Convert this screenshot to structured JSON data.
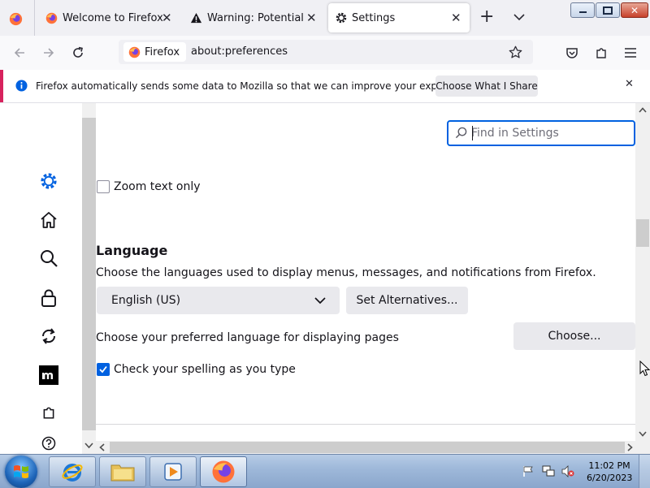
{
  "tabs": [
    {
      "title": "Welcome to Firefox",
      "close": "✕"
    },
    {
      "title": "Warning: Potential Sec",
      "close": "✕"
    },
    {
      "title": "Settings",
      "close": "✕"
    }
  ],
  "tab_controls": {
    "new_tab": "+",
    "list_all": "⌄"
  },
  "navbar": {
    "identity_label": "Firefox",
    "url": "about:preferences"
  },
  "notification": {
    "message": "Firefox automatically sends some data to Mozilla so that we can improve your experience.",
    "button": "Choose What I Share",
    "close": "✕"
  },
  "settings": {
    "search_placeholder": "Find in Settings",
    "zoom_text_only": {
      "label": "Zoom text only",
      "checked": false
    },
    "language": {
      "heading": "Language",
      "description": "Choose the languages used to display menus, messages, and notifications from Firefox.",
      "selected": "English (US)",
      "set_alternatives": "Set Alternatives...",
      "pages_description": "Choose your preferred language for displaying pages",
      "choose": "Choose...",
      "spellcheck": {
        "label": "Check your spelling as you type",
        "checked": true
      }
    }
  },
  "taskbar": {
    "time": "11:02 PM",
    "date": "6/20/2023"
  },
  "colors": {
    "accent": "#0061e0",
    "notification_accent": "#d7225d"
  }
}
